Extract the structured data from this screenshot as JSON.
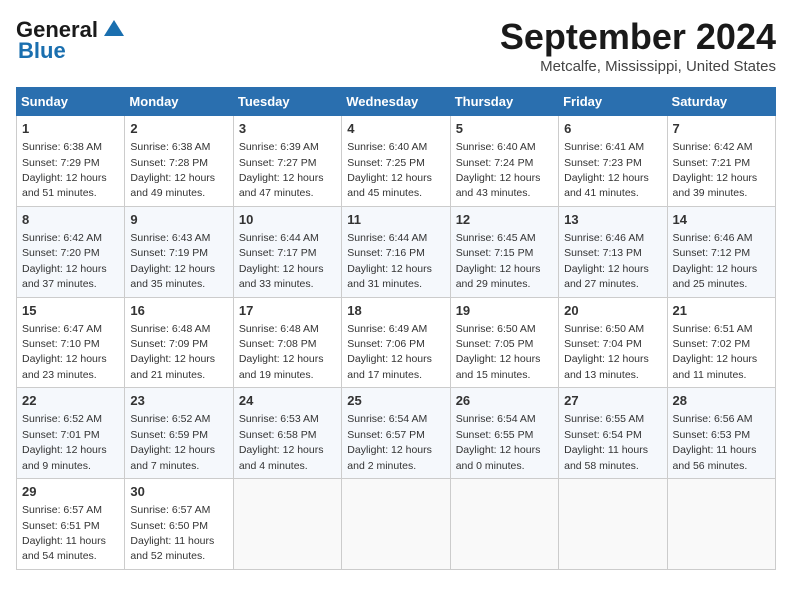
{
  "header": {
    "logo_general": "General",
    "logo_blue": "Blue",
    "month_title": "September 2024",
    "location": "Metcalfe, Mississippi, United States"
  },
  "days_of_week": [
    "Sunday",
    "Monday",
    "Tuesday",
    "Wednesday",
    "Thursday",
    "Friday",
    "Saturday"
  ],
  "weeks": [
    [
      {
        "day": 1,
        "sunrise": "6:38 AM",
        "sunset": "7:29 PM",
        "daylight": "12 hours and 51 minutes."
      },
      {
        "day": 2,
        "sunrise": "6:38 AM",
        "sunset": "7:28 PM",
        "daylight": "12 hours and 49 minutes."
      },
      {
        "day": 3,
        "sunrise": "6:39 AM",
        "sunset": "7:27 PM",
        "daylight": "12 hours and 47 minutes."
      },
      {
        "day": 4,
        "sunrise": "6:40 AM",
        "sunset": "7:25 PM",
        "daylight": "12 hours and 45 minutes."
      },
      {
        "day": 5,
        "sunrise": "6:40 AM",
        "sunset": "7:24 PM",
        "daylight": "12 hours and 43 minutes."
      },
      {
        "day": 6,
        "sunrise": "6:41 AM",
        "sunset": "7:23 PM",
        "daylight": "12 hours and 41 minutes."
      },
      {
        "day": 7,
        "sunrise": "6:42 AM",
        "sunset": "7:21 PM",
        "daylight": "12 hours and 39 minutes."
      }
    ],
    [
      {
        "day": 8,
        "sunrise": "6:42 AM",
        "sunset": "7:20 PM",
        "daylight": "12 hours and 37 minutes."
      },
      {
        "day": 9,
        "sunrise": "6:43 AM",
        "sunset": "7:19 PM",
        "daylight": "12 hours and 35 minutes."
      },
      {
        "day": 10,
        "sunrise": "6:44 AM",
        "sunset": "7:17 PM",
        "daylight": "12 hours and 33 minutes."
      },
      {
        "day": 11,
        "sunrise": "6:44 AM",
        "sunset": "7:16 PM",
        "daylight": "12 hours and 31 minutes."
      },
      {
        "day": 12,
        "sunrise": "6:45 AM",
        "sunset": "7:15 PM",
        "daylight": "12 hours and 29 minutes."
      },
      {
        "day": 13,
        "sunrise": "6:46 AM",
        "sunset": "7:13 PM",
        "daylight": "12 hours and 27 minutes."
      },
      {
        "day": 14,
        "sunrise": "6:46 AM",
        "sunset": "7:12 PM",
        "daylight": "12 hours and 25 minutes."
      }
    ],
    [
      {
        "day": 15,
        "sunrise": "6:47 AM",
        "sunset": "7:10 PM",
        "daylight": "12 hours and 23 minutes."
      },
      {
        "day": 16,
        "sunrise": "6:48 AM",
        "sunset": "7:09 PM",
        "daylight": "12 hours and 21 minutes."
      },
      {
        "day": 17,
        "sunrise": "6:48 AM",
        "sunset": "7:08 PM",
        "daylight": "12 hours and 19 minutes."
      },
      {
        "day": 18,
        "sunrise": "6:49 AM",
        "sunset": "7:06 PM",
        "daylight": "12 hours and 17 minutes."
      },
      {
        "day": 19,
        "sunrise": "6:50 AM",
        "sunset": "7:05 PM",
        "daylight": "12 hours and 15 minutes."
      },
      {
        "day": 20,
        "sunrise": "6:50 AM",
        "sunset": "7:04 PM",
        "daylight": "12 hours and 13 minutes."
      },
      {
        "day": 21,
        "sunrise": "6:51 AM",
        "sunset": "7:02 PM",
        "daylight": "12 hours and 11 minutes."
      }
    ],
    [
      {
        "day": 22,
        "sunrise": "6:52 AM",
        "sunset": "7:01 PM",
        "daylight": "12 hours and 9 minutes."
      },
      {
        "day": 23,
        "sunrise": "6:52 AM",
        "sunset": "6:59 PM",
        "daylight": "12 hours and 7 minutes."
      },
      {
        "day": 24,
        "sunrise": "6:53 AM",
        "sunset": "6:58 PM",
        "daylight": "12 hours and 4 minutes."
      },
      {
        "day": 25,
        "sunrise": "6:54 AM",
        "sunset": "6:57 PM",
        "daylight": "12 hours and 2 minutes."
      },
      {
        "day": 26,
        "sunrise": "6:54 AM",
        "sunset": "6:55 PM",
        "daylight": "12 hours and 0 minutes."
      },
      {
        "day": 27,
        "sunrise": "6:55 AM",
        "sunset": "6:54 PM",
        "daylight": "11 hours and 58 minutes."
      },
      {
        "day": 28,
        "sunrise": "6:56 AM",
        "sunset": "6:53 PM",
        "daylight": "11 hours and 56 minutes."
      }
    ],
    [
      {
        "day": 29,
        "sunrise": "6:57 AM",
        "sunset": "6:51 PM",
        "daylight": "11 hours and 54 minutes."
      },
      {
        "day": 30,
        "sunrise": "6:57 AM",
        "sunset": "6:50 PM",
        "daylight": "11 hours and 52 minutes."
      },
      null,
      null,
      null,
      null,
      null
    ]
  ]
}
